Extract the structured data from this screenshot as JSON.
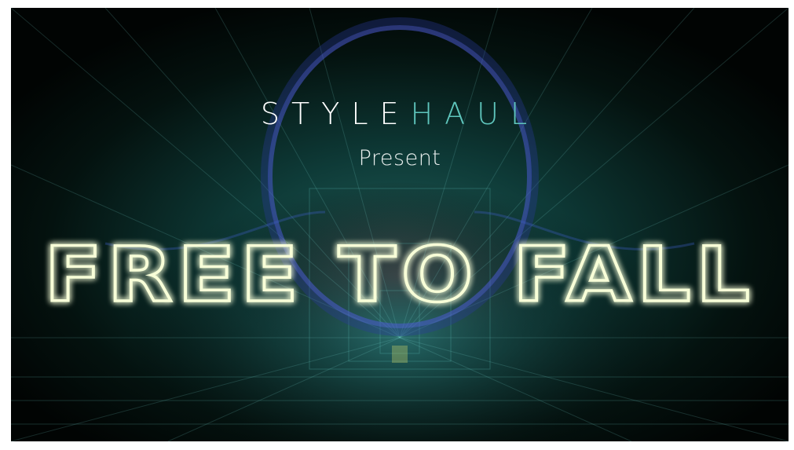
{
  "brand": {
    "part1": "STYLE",
    "part2": "HAUL",
    "color_part1": "#ffffff",
    "color_part2": "#5fc6bd"
  },
  "subtitle": "Present",
  "title": "FREE TO FALL",
  "colors": {
    "title_glow": "#d4f27a",
    "title_stroke": "#f8ffd8",
    "background": "#020807"
  }
}
